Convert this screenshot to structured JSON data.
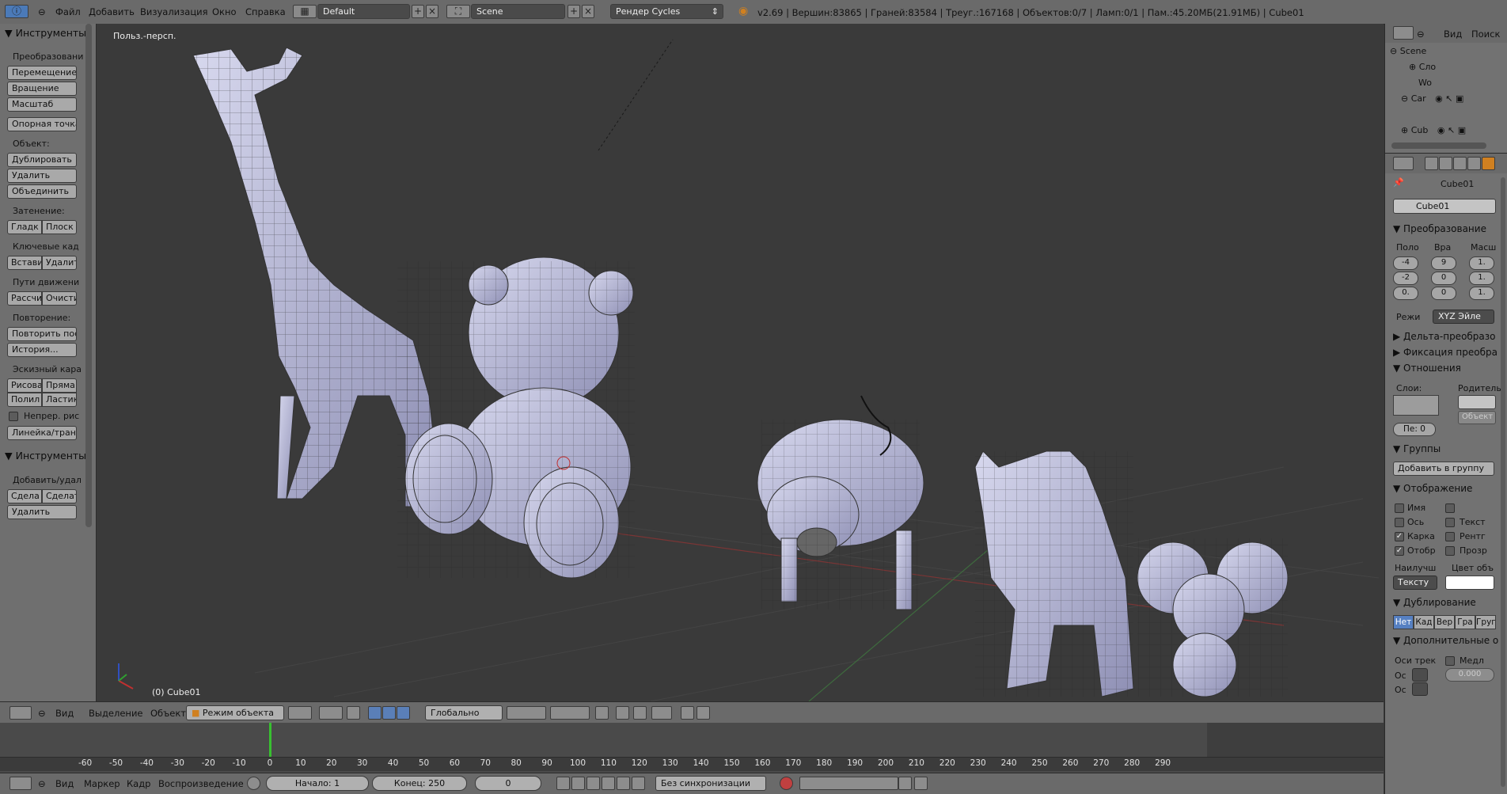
{
  "topbar": {
    "menus": [
      "Файл",
      "Добавить",
      "Визуализация",
      "Окно",
      "Справка"
    ],
    "layout": "Default",
    "scene": "Scene",
    "render_engine": "Рендер Cycles",
    "stats": "v2.69 | Вершин:83865 | Граней:83584 | Треуг.:167168 | Объектов:0/7 | Ламп:0/1 | Пам.:45.20МБ(21.91МБ) | Cube01"
  },
  "toolshelf": {
    "tools_header": "Инструменты",
    "transform_label": "Преобразовани",
    "move": "Перемещение",
    "rotate": "Вращение",
    "scale": "Масштаб",
    "origin": "Опорная точка",
    "object_label": "Объект:",
    "duplicate": "Дублировать",
    "delete": "Удалить",
    "join": "Объединить",
    "shading_label": "Затенение:",
    "smooth": "Гладк",
    "flat": "Плоск",
    "keyframes_label": "Ключевые кад",
    "insert": "Встави",
    "remove": "Удалит",
    "motion_label": "Пути движени",
    "calc": "Рассчи",
    "clear": "Очисти",
    "repeat_label": "Повторение:",
    "repeat_last": "Повторить пос",
    "history": "История...",
    "grease_label": "Эскизный кара",
    "draw": "Рисова",
    "line": "Прямa",
    "poly": "Полил",
    "eraser": "Ластик",
    "continuous": "Непрер. рис",
    "ruler": "Линейка/транс",
    "tools2_header": "Инструменты",
    "add_remove_label": "Добавить/удал",
    "make1": "Сдела",
    "make2": "Сделат",
    "delete2": "Удалить"
  },
  "viewport": {
    "view_name": "Польз.-персп.",
    "active_object": "(0) Cube01"
  },
  "viewport_header": {
    "view": "Вид",
    "select": "Выделение",
    "object": "Объект",
    "mode": "Режим объекта",
    "orientation": "Глобально"
  },
  "timeline": {
    "ticks": [
      -60,
      -50,
      -40,
      -30,
      -20,
      -10,
      0,
      10,
      20,
      30,
      40,
      50,
      60,
      70,
      80,
      90,
      100,
      110,
      120,
      130,
      140,
      150,
      160,
      170,
      180,
      190,
      200,
      210,
      220,
      230,
      240,
      250,
      260,
      270,
      280,
      290
    ],
    "current_frame_marker": 0,
    "view": "Вид",
    "marker": "Маркер",
    "frame": "Кадр",
    "playback": "Воспроизведение",
    "start": "Начало: 1",
    "end": "Конец: 250",
    "current": "0",
    "sync": "Без синхронизации"
  },
  "outliner": {
    "view": "Вид",
    "search": "Поиск",
    "items": [
      "Scene",
      "Сло",
      "Wo",
      "Car",
      "Cub"
    ]
  },
  "properties": {
    "object_name": "Cube01",
    "object_field": "Cube01",
    "transform_header": "Преобразование",
    "col_loc": "Поло",
    "col_rot": "Вра",
    "col_scale": "Масш",
    "loc": [
      "-4",
      "-2",
      "0."
    ],
    "rot": [
      "9",
      "0",
      "0"
    ],
    "scale": [
      "1.",
      "1.",
      "1."
    ],
    "mode_label": "Режи",
    "mode_value": "XYZ Эйле",
    "delta_header": "Дельта-преобразо",
    "lock_header": "Фиксация преобра",
    "relations_header": "Отношения",
    "layers_label": "Слои:",
    "parent_label": "Родитель",
    "parent_type": "Объект",
    "pass_index": "Пе: 0",
    "groups_header": "Группы",
    "add_to_group": "Добавить в группу",
    "display_header": "Отображение",
    "name_chk": "Имя",
    "axis_chk": "Ось",
    "texture_chk": "Текст",
    "wire_chk": "Карка",
    "xray_chk": "Рентг",
    "draw_chk": "Отобр",
    "transp_chk": "Прозр",
    "max_draw_label": "Наилучш",
    "obj_color_label": "Цвет объ",
    "max_draw_value": "Тексту",
    "dupli_header": "Дублирование",
    "dupli_tabs": [
      "Нет",
      "Кад",
      "Вер",
      "Гра",
      "Груп"
    ],
    "extra_header": "Дополнительные о",
    "track_label": "Оси трек",
    "slow_label": "Медл",
    "os1": "Ос",
    "os2": "Ос",
    "slow_value": "0.000"
  }
}
